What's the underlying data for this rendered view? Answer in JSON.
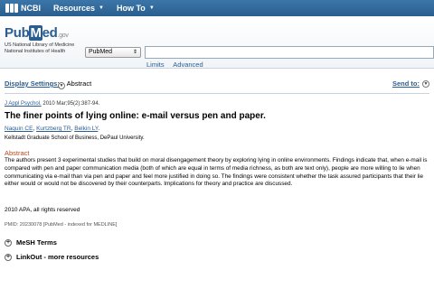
{
  "topbar": {
    "logo": "NCBI",
    "nav": [
      {
        "label": "Resources"
      },
      {
        "label": "How To"
      }
    ]
  },
  "header": {
    "logo_pub": "Pub",
    "logo_m": "M",
    "logo_ed": "ed",
    "logo_gov": ".gov",
    "lib_line1": "US National Library of Medicine",
    "lib_line2": "National Institutes of Health",
    "database": "PubMed",
    "search_value": "",
    "links": [
      "Limits",
      "Advanced"
    ]
  },
  "display": {
    "settings_label": "Display Settings:",
    "format": "Abstract",
    "send_to": "Send to:"
  },
  "article": {
    "journal": "J Appl Psychol.",
    "citation_rest": " 2010 Mar;95(2):387-94.",
    "title": "The finer points of lying online: e-mail versus pen and paper.",
    "authors": [
      "Naquin CE",
      "Kurtzberg TR",
      "Belkin LY"
    ],
    "affiliation": "Kellstadt Graduate School of Business, DePaul University.",
    "abstract_heading": "Abstract",
    "abstract": "The authors present 3 experimental studies that build on moral disengagement theory by exploring lying in online environments. Findings indicate that, when e-mail is compared with pen and paper communication media (both of which are equal in terms of media richness, as both are text only), people are more willing to lie when communicating via e-mail than via pen and paper and feel more justified in doing so. The findings were consistent whether the task assured participants that their lie either would or would not be discovered by their counterparts. Implications for theory and practice are discussed.",
    "copyright": "2010 APA, all rights reserved",
    "pmid": "PMID: 20230078 [PubMed - indexed for MEDLINE]"
  },
  "sections": {
    "mesh": "MeSH Terms",
    "linkout": "LinkOut - more resources"
  }
}
